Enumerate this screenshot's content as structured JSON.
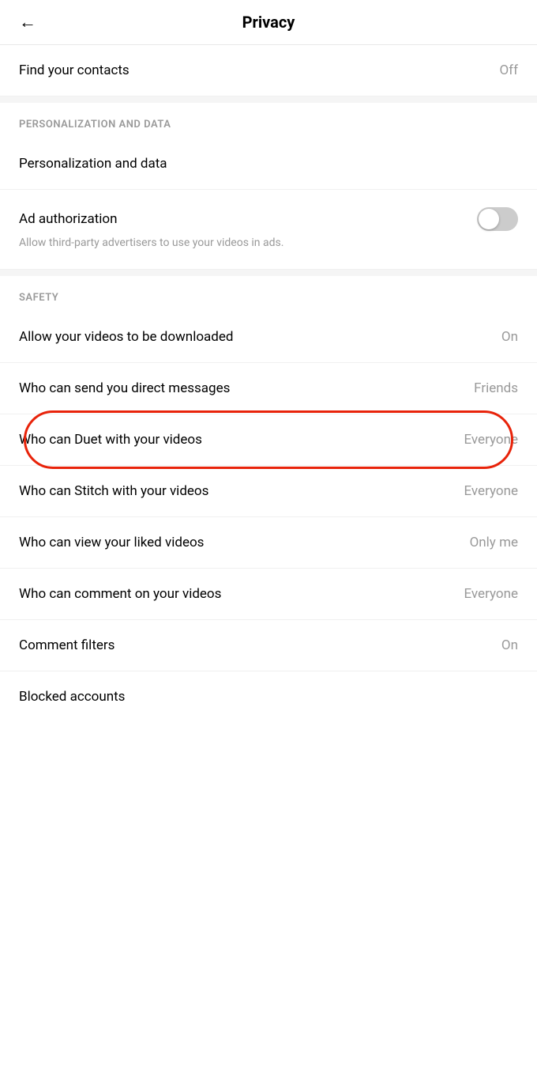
{
  "header": {
    "title": "Privacy",
    "back_label": "←"
  },
  "settings": {
    "find_contacts": {
      "label": "Find your contacts",
      "value": "Off"
    },
    "sections": [
      {
        "id": "personalization",
        "header": "PERSONALIZATION AND DATA",
        "items": [
          {
            "id": "personalization_data",
            "label": "Personalization and data",
            "value": "",
            "type": "nav"
          },
          {
            "id": "ad_authorization",
            "label": "Ad authorization",
            "desc": "Allow third-party advertisers to use your videos in ads.",
            "value": "",
            "type": "toggle",
            "toggle_on": false
          }
        ]
      },
      {
        "id": "safety",
        "header": "SAFETY",
        "items": [
          {
            "id": "allow_downloads",
            "label": "Allow your videos to be downloaded",
            "value": "On",
            "type": "nav"
          },
          {
            "id": "direct_messages",
            "label": "Who can send you direct messages",
            "value": "Friends",
            "type": "nav"
          },
          {
            "id": "duet",
            "label": "Who can Duet with your videos",
            "value": "Everyone",
            "type": "nav",
            "highlighted": true
          },
          {
            "id": "stitch",
            "label": "Who can Stitch with your videos",
            "value": "Everyone",
            "type": "nav"
          },
          {
            "id": "liked_videos",
            "label": "Who can view your liked videos",
            "value": "Only me",
            "type": "nav"
          },
          {
            "id": "comments",
            "label": "Who can comment on your videos",
            "value": "Everyone",
            "type": "nav"
          },
          {
            "id": "comment_filters",
            "label": "Comment filters",
            "value": "On",
            "type": "nav"
          },
          {
            "id": "blocked_accounts",
            "label": "Blocked accounts",
            "value": "",
            "type": "nav"
          }
        ]
      }
    ]
  }
}
